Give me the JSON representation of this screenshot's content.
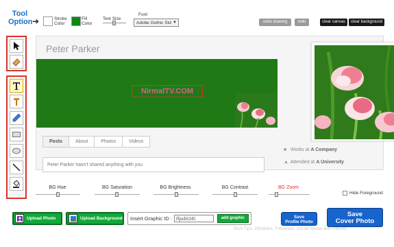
{
  "toolbar": {
    "tool_option_label": "Tool Option",
    "stroke_label": "Stroke Color",
    "fill_label": "Fill Color",
    "text_size_label": "Text Size",
    "font_label": "Font",
    "font_value": "Adobe Gothic Std",
    "undo_label": "undo drawing",
    "redo_label": "redo",
    "clear_canvas_label": "clear canvas",
    "clear_bg_label": "clear background",
    "fill_color": "#0a8a12",
    "stroke_color": "#ffffff"
  },
  "tools": [
    "select-arrow-icon",
    "eraser-icon",
    "text-icon",
    "hammer-icon",
    "pencil-icon",
    "rectangle-icon",
    "ellipse-icon",
    "line-icon",
    "fill-bucket-icon"
  ],
  "profile": {
    "name": "Peter Parker",
    "watermark": "NirmalTV.COM",
    "tabs": [
      "Posts",
      "About",
      "Photos",
      "Videos"
    ],
    "status": "Peter Parker hasn't shared anything with you",
    "works_label": "Works at",
    "works_value": "A Company",
    "attended_label": "Attended at",
    "attended_value": "A University"
  },
  "sliders": {
    "hue": "BG Hue",
    "saturation": "BG Saturation",
    "brightness": "BG Brightness",
    "contrast": "BG Contrast",
    "zoom": "BG Zoom",
    "hide_foreground": "Hide Foreground"
  },
  "bottom": {
    "upload_photo": "Upload Photo",
    "upload_background": "Upload Background",
    "insert_graphic_label": "Insert Graphic ID :",
    "graphic_id_value": "ffpxfrt245",
    "add_graphic": "add graphic",
    "save_profile_line1": "Save",
    "save_profile_line2": "Profile Photo",
    "save_cover_line1": "Save",
    "save_cover_line2": "Cover Photo"
  },
  "footer_watermark": "Tech Tips, Windows, Freeware, Social Media and Internet",
  "colors": {
    "accent_blue": "#1664cc",
    "accent_green": "#12a83a",
    "palette_border": "#d9342a",
    "zoom_label": "#d9342a",
    "cover_green": "#1f7a16"
  }
}
